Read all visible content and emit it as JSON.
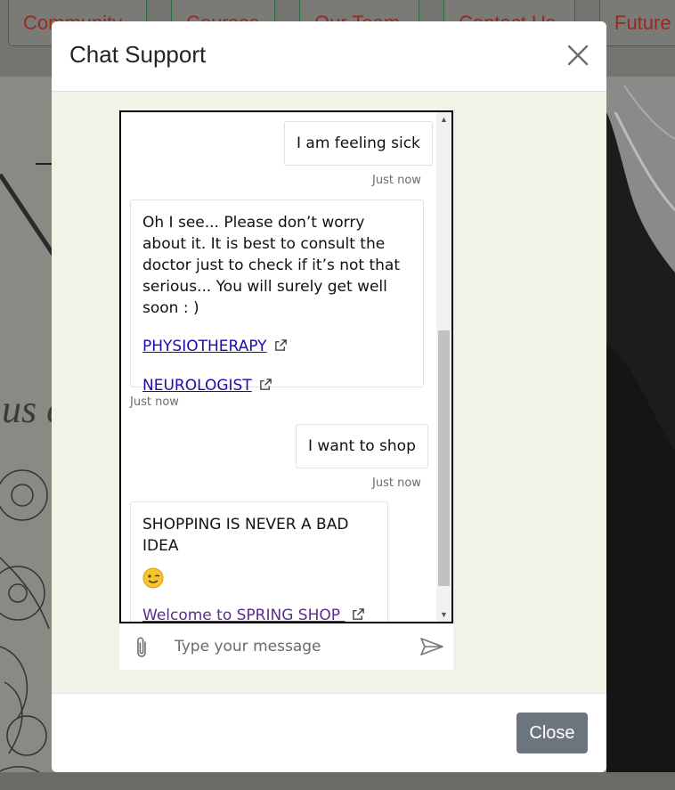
{
  "background": {
    "nav_items": [
      "Community",
      "Courses",
      "Our Team",
      "Contact Us",
      "Future"
    ],
    "hero_text": "us e"
  },
  "modal": {
    "title": "Chat Support",
    "close_label": "Close"
  },
  "chat": {
    "messages": [
      {
        "sender": "user",
        "text": "I am feeling sick",
        "time": "Just now"
      },
      {
        "sender": "bot",
        "text": "Oh I see... Please don’t worry about it. It is best to consult the doctor just to check if it’s not that serious... You will surely get well soon : )",
        "links": [
          "PHYSIOTHERAPY",
          "NEUROLOGIST"
        ],
        "time": "Just now"
      },
      {
        "sender": "user",
        "text": "I want to shop",
        "time": "Just now"
      },
      {
        "sender": "bot",
        "text": "SHOPPING IS NEVER A BAD IDEA",
        "emoji": "winking-face",
        "links": [
          "Welcome to SPRING SHOP "
        ]
      }
    ],
    "input_placeholder": "Type your message"
  },
  "colors": {
    "modal_body_bg": "#f2f2e6",
    "close_button_bg": "#6c757d",
    "link": "#1a0dab",
    "visited_link": "#5b2d8c"
  }
}
